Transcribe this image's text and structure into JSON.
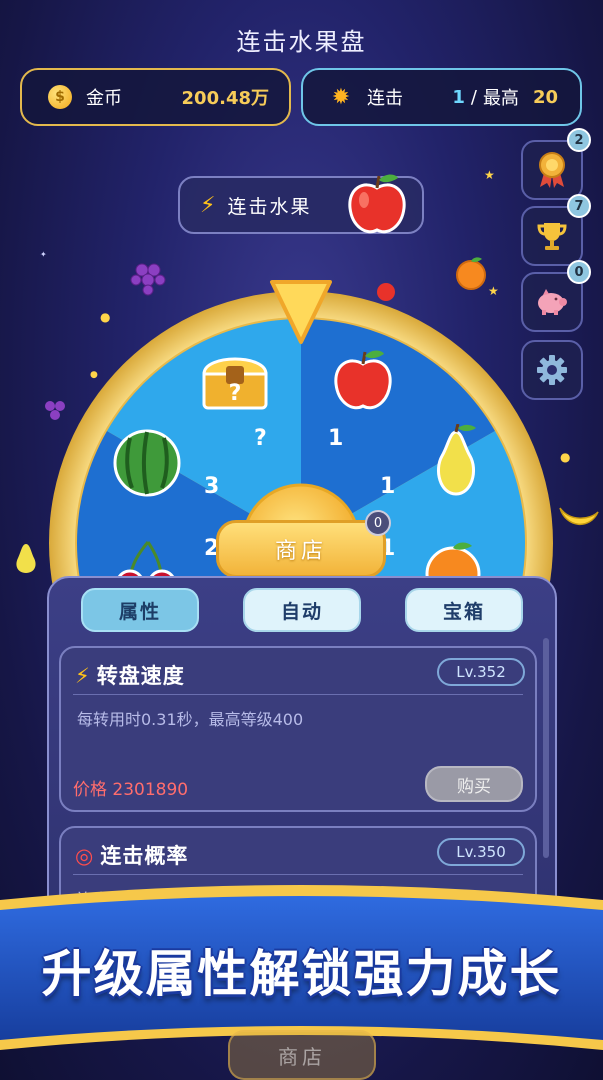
{
  "header": {
    "title": "连击水果盘"
  },
  "coins": {
    "label": "金币",
    "value": "200.48万"
  },
  "combo": {
    "label": "连击",
    "current": "1",
    "separator": "/",
    "best_label": "最高",
    "best_value": "20"
  },
  "side_buttons": [
    {
      "icon": "medal-icon",
      "badge": "2"
    },
    {
      "icon": "trophy-icon",
      "badge": "7"
    },
    {
      "icon": "piggy-bank-icon",
      "badge": "0"
    },
    {
      "icon": "gear-icon"
    }
  ],
  "combo_fruit": {
    "label": "连击水果",
    "fruit": "apple"
  },
  "wheel": {
    "segments": [
      {
        "fruit": "apple",
        "value": "1"
      },
      {
        "fruit": "pear",
        "value": "1"
      },
      {
        "fruit": "orange",
        "value": "1"
      },
      {
        "fruit": "cherry",
        "value": "2"
      },
      {
        "fruit": "watermelon",
        "value": "3"
      },
      {
        "fruit": "mystery-chest",
        "value": "?"
      }
    ]
  },
  "shop": {
    "label": "商店",
    "badge": "0"
  },
  "tabs": [
    {
      "label": "属性",
      "active": true
    },
    {
      "label": "自动",
      "active": false
    },
    {
      "label": "宝箱",
      "active": false
    }
  ],
  "upgrades": [
    {
      "icon": "lightning-icon",
      "title": "转盘速度",
      "level": "Lv.352",
      "desc": "每转用时0.31秒，最高等级400",
      "price_label": "价格",
      "price": "2301890",
      "buy_label": "购买"
    },
    {
      "icon": "target-icon",
      "title": "连击概率",
      "level": "Lv.350",
      "desc": "连击概率84.19%，最高等级400"
    }
  ],
  "promo": {
    "text": "升级属性解锁强力成长",
    "ghost_shop": "商店"
  },
  "colors": {
    "gold": "#f7cc59",
    "cyan": "#6fd8ff",
    "price_red": "#ff6d6d",
    "wheel_dark": "#1e6fd1",
    "wheel_light": "#2fa8ec",
    "rim": "#f6d56a"
  }
}
